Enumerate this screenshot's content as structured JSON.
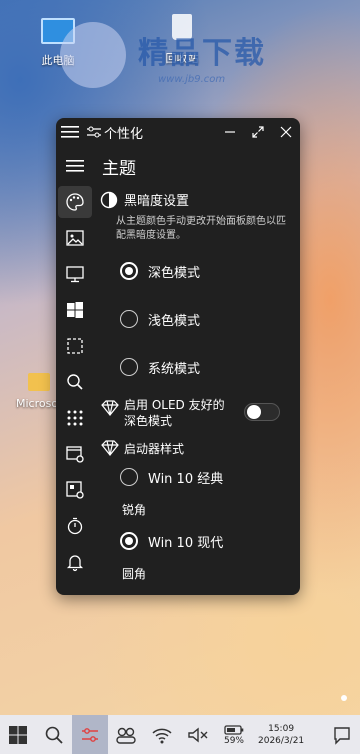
{
  "desktop": {
    "icons": [
      {
        "label": "此电脑"
      },
      {
        "label": "回收站"
      },
      {
        "label": "Microso"
      }
    ],
    "watermark": {
      "text": "精品下载",
      "url": "www.jb9.com"
    }
  },
  "window": {
    "title": "个性化",
    "page_title": "主题",
    "dark_section": {
      "title": "黑暗度设置",
      "description": "从主题颜色手动更改开始面板颜色以匹配黑暗度设置。",
      "options": [
        {
          "label": "深色模式",
          "selected": true
        },
        {
          "label": "浅色模式",
          "selected": false
        },
        {
          "label": "系统模式",
          "selected": false
        }
      ]
    },
    "oled": {
      "label": "启用 OLED 友好的深色模式",
      "enabled": false
    },
    "launcher": {
      "title": "启动器样式",
      "options": [
        {
          "label": "Win 10 经典",
          "sub": "锐角",
          "selected": false
        },
        {
          "label": "Win 10 现代",
          "sub": "圆角",
          "selected": true
        }
      ]
    }
  },
  "taskbar": {
    "battery": "59%",
    "time": "15:09",
    "date": "2026/3/21"
  }
}
